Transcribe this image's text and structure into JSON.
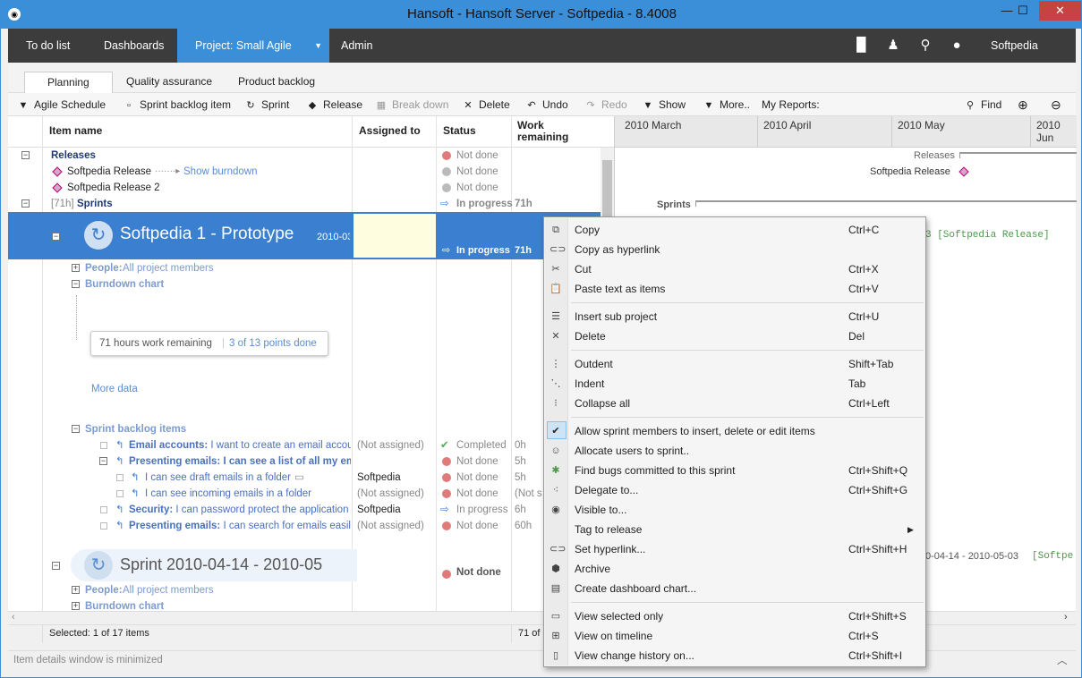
{
  "window": {
    "title": "Hansoft - Hansoft Server - Softpedia - 8.4008",
    "minimize": "—",
    "maximize": "☐",
    "close": "✕"
  },
  "nav": {
    "todo": "To do list",
    "dashboards": "Dashboards",
    "project": "Project: Small Agile",
    "admin": "Admin",
    "user": "Softpedia"
  },
  "subtabs": {
    "planning": "Planning",
    "qa": "Quality assurance",
    "backlog": "Product backlog"
  },
  "toolbar": {
    "agile": "Agile Schedule",
    "sprint_backlog_item": "Sprint backlog item",
    "sprint": "Sprint",
    "release": "Release",
    "break_down": "Break down",
    "delete": "Delete",
    "undo": "Undo",
    "redo": "Redo",
    "show": "Show",
    "more": "More..",
    "my_reports": "My Reports:",
    "find": "Find"
  },
  "columns": {
    "name": "Item name",
    "assigned": "Assigned to",
    "status": "Status",
    "work": "Work remaining"
  },
  "rows": {
    "releases": "Releases",
    "rel1": "Softpedia Release",
    "show_burndown": "Show burndown",
    "rel2": "Softpedia Release 2",
    "sprints_prefix": "[71h]",
    "sprints": "Sprints",
    "sprint1": "Softpedia 1 - Prototype",
    "sprint1_date": "2010-03",
    "sprint1_status": "In progress",
    "sprint1_work": "71h",
    "people": "People:",
    "people_val": "All project members",
    "burndown": "Burndown chart",
    "burndown_hours": "71 hours work remaining",
    "burndown_points": "3 of 13 points done",
    "more_data": "More data",
    "sbi": "Sprint backlog items",
    "r1_a": "Email accounts:",
    "r1_b": " I want to create an email accour",
    "r1_assign": "(Not assigned)",
    "r1_status": "Completed",
    "r1_work": "0h",
    "r2_a": "Presenting emails:",
    "r2_b": " I can see a list of all my email",
    "r2_status": "Not done",
    "r2_work": "5h",
    "r3": "I can see draft emails in a folder",
    "r3_assign": "Softpedia",
    "r3_status": "Not done",
    "r3_work": "5h",
    "r4": "I can see incoming emails in a folder",
    "r4_assign": "(Not assigned)",
    "r4_status": "Not done",
    "r4_work": "(Not s",
    "r5_a": "Security:",
    "r5_b": " I can password protect the application",
    "r5_assign": "Softpedia",
    "r5_status": "In progress",
    "r5_work": "6h",
    "r6_a": "Presenting emails:",
    "r6_b": " I can search for emails easily",
    "r6_assign": "(Not assigned)",
    "r6_status": "Not done",
    "r6_work": "60h",
    "sprint2": "Sprint 2010-04-14 - 2010-05",
    "sprint2_status": "Not done",
    "people2": "People:",
    "people2_val": "All project members",
    "burndown2": "Burndown chart",
    "not_done": "Not done",
    "in_progress": "In progress",
    "work71": "71h"
  },
  "gantt": {
    "m1": "2010 March",
    "m2": "2010 April",
    "m3": "2010 May",
    "m4": "2010 Jun",
    "releases": "Releases",
    "rel1": "Softpedia Release",
    "sprints": "Sprints",
    "tag1": "3 [Softpedia Release]",
    "tag2": "0-04-14 - 2010-05-03",
    "tag2b": "[Softpe"
  },
  "status": {
    "selected": "Selected: 1 of 17 items",
    "value": "71 of"
  },
  "bottom": {
    "msg": "Item details window is minimized"
  },
  "menu": {
    "copy": "Copy",
    "copy_sc": "Ctrl+C",
    "copy_link": "Copy as hyperlink",
    "cut": "Cut",
    "cut_sc": "Ctrl+X",
    "paste": "Paste text as items",
    "paste_sc": "Ctrl+V",
    "insert": "Insert sub project",
    "insert_sc": "Ctrl+U",
    "delete": "Delete",
    "delete_sc": "Del",
    "outdent": "Outdent",
    "outdent_sc": "Shift+Tab",
    "indent": "Indent",
    "indent_sc": "Tab",
    "collapse": "Collapse all",
    "collapse_sc": "Ctrl+Left",
    "allow": "Allow sprint  members to insert, delete or edit items",
    "allocate": "Allocate users to sprint..",
    "findbugs": "Find bugs committed to this sprint",
    "findbugs_sc": "Ctrl+Shift+Q",
    "delegate": "Delegate to...",
    "delegate_sc": "Ctrl+Shift+G",
    "visible": "Visible to...",
    "tag": "Tag to release",
    "sethyper": "Set hyperlink...",
    "sethyper_sc": "Ctrl+Shift+H",
    "archive": "Archive",
    "dashchart": "Create dashboard chart...",
    "viewsel": "View selected only",
    "viewsel_sc": "Ctrl+Shift+S",
    "viewtime": "View on timeline",
    "viewtime_sc": "Ctrl+S",
    "viewhist": "View change history on...",
    "viewhist_sc": "Ctrl+Shift+I"
  }
}
